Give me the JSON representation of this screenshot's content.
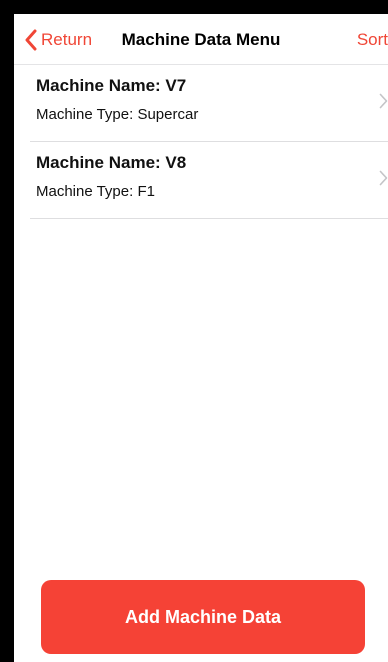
{
  "colors": {
    "accent": "#f04636",
    "button_background": "#f54236",
    "separator": "#dedee0",
    "frame": "#000000"
  },
  "navbar": {
    "back_label": "Return",
    "back_icon": "chevron-left-icon",
    "title": "Machine Data Menu",
    "sort_label": "Sort"
  },
  "machines": [
    {
      "name": "Machine Name: V7",
      "type": "Machine Type: Supercar",
      "disclosure_icon": "chevron-right-icon"
    },
    {
      "name": "Machine Name: V8",
      "type": "Machine Type: F1",
      "disclosure_icon": "chevron-right-icon"
    }
  ],
  "footer": {
    "add_button_label": "Add Machine Data"
  }
}
